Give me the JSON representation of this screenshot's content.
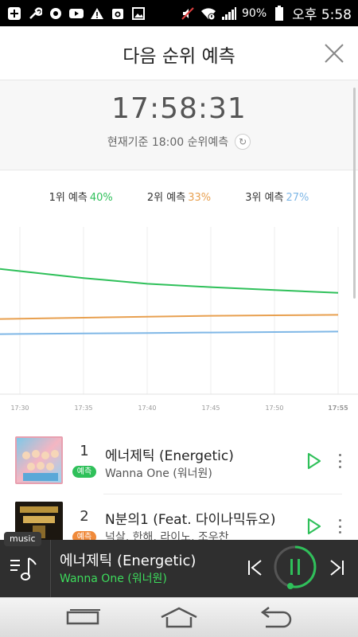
{
  "status_bar": {
    "battery": "90%",
    "time": "오후 5:58",
    "icons": [
      "plus-square-icon",
      "wrench-icon",
      "music-note-icon",
      "youtube-icon",
      "warning-icon",
      "camera-icon",
      "image-icon",
      "mute-icon",
      "wifi-icon",
      "signal-icon",
      "battery-icon"
    ]
  },
  "header": {
    "title": "다음 순위 예측",
    "close_icon": "close-icon"
  },
  "timer": {
    "clock": "17:58:31",
    "basis": "현재기준 18:00 순위예측"
  },
  "legend": [
    {
      "label": "1위 예측",
      "pct": "40%",
      "color": "#2fc05a"
    },
    {
      "label": "2위 예측",
      "pct": "33%",
      "color": "#e8a050"
    },
    {
      "label": "3위 예측",
      "pct": "27%",
      "color": "#7fb7e6"
    }
  ],
  "chart_data": {
    "type": "line",
    "x": [
      "17:30",
      "17:35",
      "17:40",
      "17:45",
      "17:50",
      "17:55"
    ],
    "series": [
      {
        "name": "1위 예측",
        "color": "#2fc05a",
        "values": [
          51.5,
          48.6,
          46.2,
          44.8,
          43.6,
          42.4
        ]
      },
      {
        "name": "2위 예측",
        "color": "#e8a050",
        "values": [
          31.6,
          32.0,
          32.4,
          32.8,
          33.0,
          33.2
        ]
      },
      {
        "name": "3위 예측",
        "color": "#7fb7e6",
        "values": [
          25.2,
          25.4,
          25.6,
          25.8,
          26.0,
          26.2
        ]
      }
    ],
    "ylim": [
      0,
      70
    ],
    "grid": true
  },
  "songs": [
    {
      "rank": "1",
      "badge": "예측",
      "badge_color": "#2fc05a",
      "title": "에너제틱 (Energetic)",
      "artist": "Wanna One (워너원)"
    },
    {
      "rank": "2",
      "badge": "예측",
      "badge_color": "#f08a3a",
      "title": "N분의1 (Feat. 다이나믹듀오)",
      "artist": "넉살, 한해, 라이노, 조우찬"
    }
  ],
  "player": {
    "tag": "music",
    "title": "에너제틱 (Energetic)",
    "artist": "Wanna One (워너원)"
  }
}
